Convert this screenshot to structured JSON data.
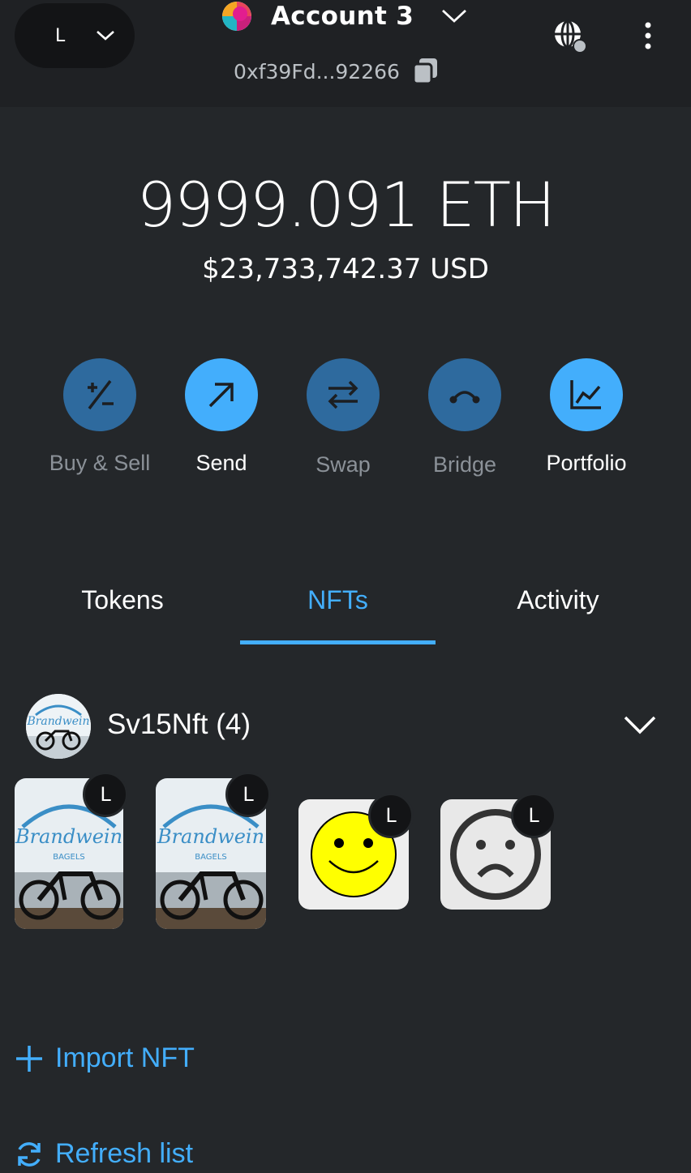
{
  "header": {
    "network_letter": "L",
    "account_name": "Account 3",
    "address": "0xf39Fd...92266"
  },
  "balance": {
    "eth": "9999.091 ETH",
    "fiat": "$23,733,742.37 USD"
  },
  "actions": [
    {
      "label": "Buy & Sell",
      "icon": "plus-minus-icon",
      "enabled": false
    },
    {
      "label": "Send",
      "icon": "arrow-up-right-icon",
      "enabled": true
    },
    {
      "label": "Swap",
      "icon": "swap-arrows-icon",
      "enabled": false
    },
    {
      "label": "Bridge",
      "icon": "bridge-icon",
      "enabled": false
    },
    {
      "label": "Portfolio",
      "icon": "chart-icon",
      "enabled": true
    }
  ],
  "tabs": [
    {
      "label": "Tokens",
      "active": false
    },
    {
      "label": "NFTs",
      "active": true
    },
    {
      "label": "Activity",
      "active": false
    }
  ],
  "collection": {
    "name": "Sv15Nft (4)",
    "items": [
      {
        "image": "bagel-bike-photo",
        "badge": "L"
      },
      {
        "image": "bagel-bike-photo",
        "badge": "L"
      },
      {
        "image": "smiley-face",
        "badge": "L"
      },
      {
        "image": "sad-face",
        "badge": "L"
      }
    ]
  },
  "links": {
    "import_nft": "Import NFT",
    "refresh_list": "Refresh list"
  },
  "colors": {
    "accent": "#43aefc",
    "background": "#24272a",
    "header": "#1f2124"
  }
}
